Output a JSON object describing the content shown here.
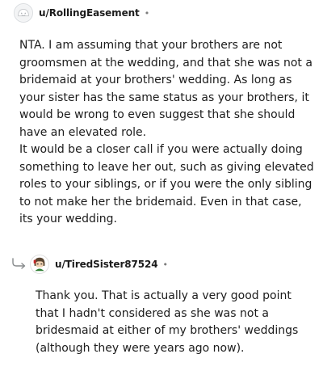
{
  "comments": [
    {
      "username": "u/RollingEasement",
      "separator": "•",
      "avatar_icon": "default-avatar-icon",
      "paragraphs": [
        "NTA. I am assuming that your brothers are not groomsmen at the wedding, and that she was not a bridemaid at your brothers' wedding. As long as your sister has the same status as your brothers, it would be wrong to even suggest that she should have an elevated role.",
        "It would be a closer call if you were actually doing something to leave her out, such as giving elevated roles to your siblings, or if you were the only sibling to not make her the bridemaid. Even in that case, its your wedding."
      ]
    },
    {
      "username": "u/TiredSister87524",
      "separator": "•",
      "avatar_icon": "custom-avatar-icon",
      "reply_icon": "reply-arrow-icon",
      "paragraphs": [
        "Thank you. That is actually a very good point that I hadn't considered as she was not a bridesmaid at either of my brothers' weddings (although they were years ago now)."
      ]
    }
  ]
}
